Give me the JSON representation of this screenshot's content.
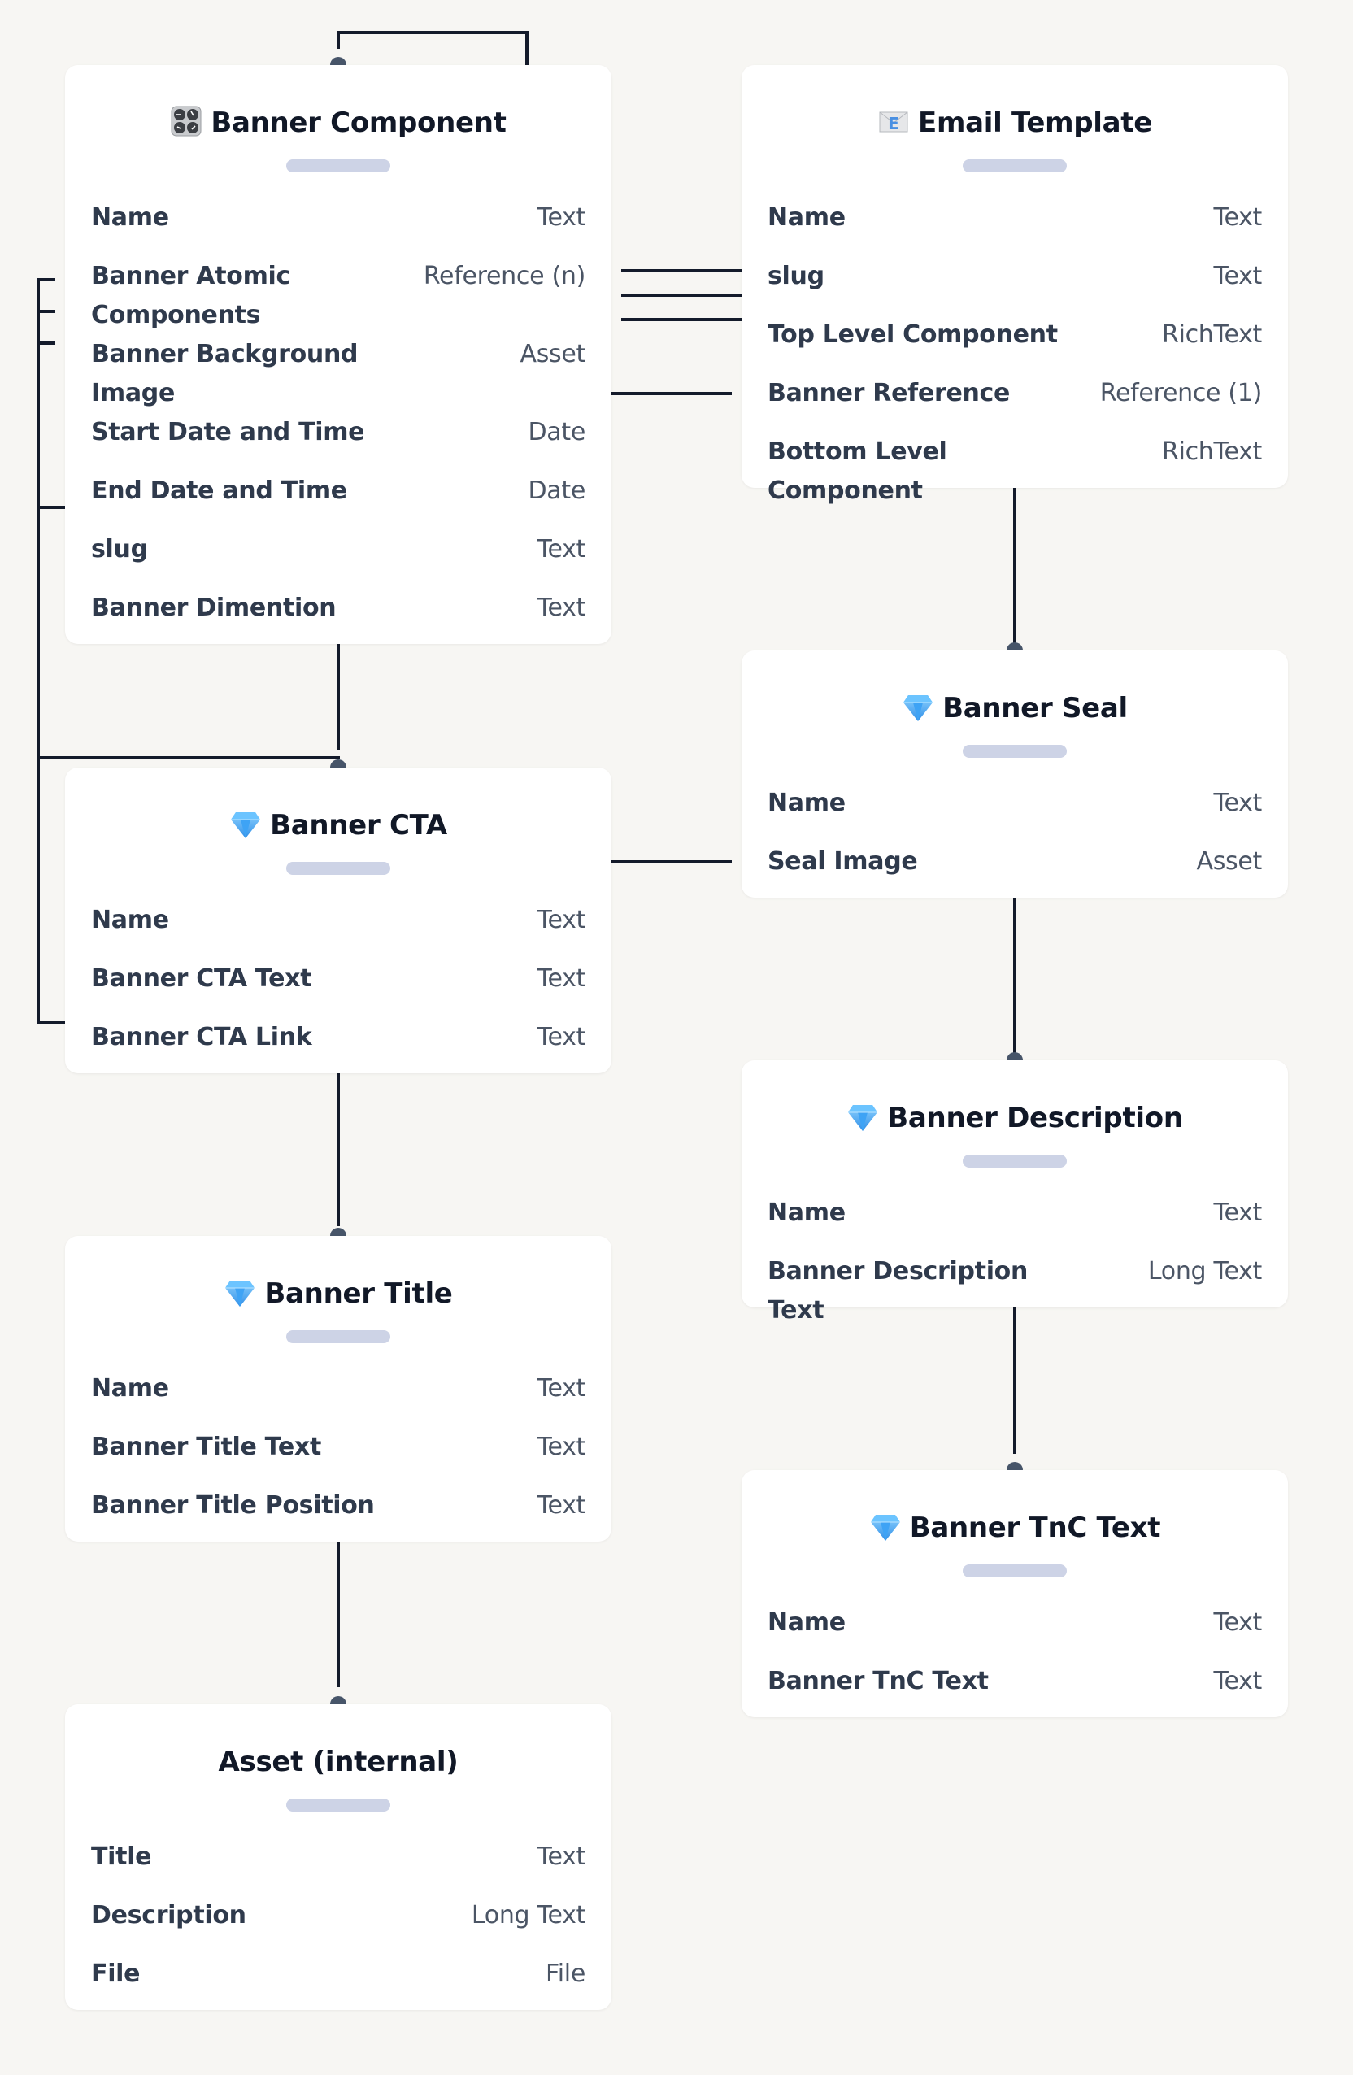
{
  "colors": {
    "background": "#f7f6f3",
    "card": "#ffffff",
    "connector": "#141b2b",
    "connector_dot": "#475569",
    "pill": "#cdd3e6",
    "title_text": "#111827",
    "field_text": "#2f3a4c",
    "type_text": "#4b5565"
  },
  "entities": {
    "banner_component": {
      "icon": "control-knobs-icon",
      "title": "Banner Component",
      "fields": [
        {
          "name": "Name",
          "type": "Text"
        },
        {
          "name": "Banner Atomic Components",
          "type": "Reference (n)"
        },
        {
          "name": "Banner Background Image",
          "type": "Asset"
        },
        {
          "name": "Start Date and Time",
          "type": "Date"
        },
        {
          "name": "End Date and Time",
          "type": "Date"
        },
        {
          "name": "slug",
          "type": "Text"
        },
        {
          "name": "Banner Dimention",
          "type": "Text"
        }
      ]
    },
    "email_template": {
      "icon": "email-envelope-icon",
      "title": "Email Template",
      "fields": [
        {
          "name": "Name",
          "type": "Text"
        },
        {
          "name": "slug",
          "type": "Text"
        },
        {
          "name": "Top Level Component",
          "type": "RichText"
        },
        {
          "name": "Banner Reference",
          "type": "Reference (1)"
        },
        {
          "name": "Bottom Level Component",
          "type": "RichText"
        }
      ]
    },
    "banner_seal": {
      "icon": "gem-icon",
      "title": "Banner Seal",
      "fields": [
        {
          "name": "Name",
          "type": "Text"
        },
        {
          "name": "Seal Image",
          "type": "Asset"
        }
      ]
    },
    "banner_cta": {
      "icon": "gem-icon",
      "title": "Banner CTA",
      "fields": [
        {
          "name": "Name",
          "type": "Text"
        },
        {
          "name": "Banner CTA Text",
          "type": "Text"
        },
        {
          "name": "Banner CTA Link",
          "type": "Text"
        }
      ]
    },
    "banner_description": {
      "icon": "gem-icon",
      "title": "Banner Description",
      "fields": [
        {
          "name": "Name",
          "type": "Text"
        },
        {
          "name": "Banner Description Text",
          "type": "Long Text"
        }
      ]
    },
    "banner_title": {
      "icon": "gem-icon",
      "title": "Banner Title",
      "fields": [
        {
          "name": "Name",
          "type": "Text"
        },
        {
          "name": "Banner Title Text",
          "type": "Text"
        },
        {
          "name": "Banner Title Position",
          "type": "Text"
        }
      ]
    },
    "banner_tnc_text": {
      "icon": "gem-icon",
      "title": "Banner TnC Text",
      "fields": [
        {
          "name": "Name",
          "type": "Text"
        },
        {
          "name": "Banner TnC Text",
          "type": "Text"
        }
      ]
    },
    "asset_internal": {
      "icon": "",
      "title": "Asset (internal)",
      "fields": [
        {
          "name": "Title",
          "type": "Text"
        },
        {
          "name": "Description",
          "type": "Long Text"
        },
        {
          "name": "File",
          "type": "File"
        }
      ]
    }
  },
  "relationships": [
    {
      "from": "banner_component",
      "to": "banner_component",
      "kind": "self-reference"
    },
    {
      "from": "banner_component",
      "to": "email_template"
    },
    {
      "from": "banner_component",
      "to": "banner_cta"
    },
    {
      "from": "banner_component",
      "to": "banner_seal"
    },
    {
      "from": "email_template",
      "to": "banner_seal"
    },
    {
      "from": "banner_cta",
      "to": "banner_title"
    },
    {
      "from": "banner_seal",
      "to": "banner_description"
    },
    {
      "from": "banner_title",
      "to": "asset_internal"
    },
    {
      "from": "banner_description",
      "to": "banner_tnc_text"
    }
  ]
}
